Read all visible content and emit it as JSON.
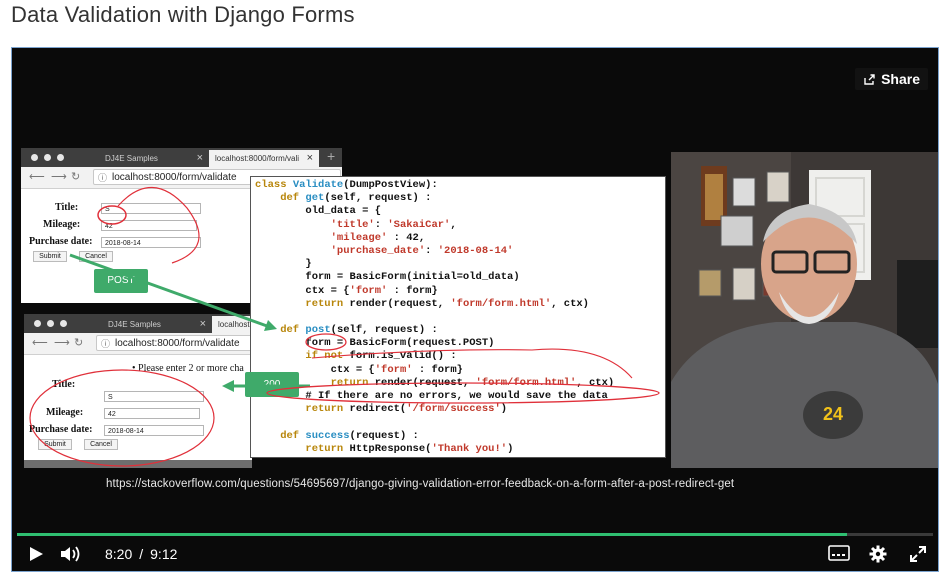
{
  "page": {
    "title": "Data Validation with Django Forms"
  },
  "player": {
    "share_label": "Share",
    "current_time": "8:20",
    "time_separator": "/",
    "duration": "9:12",
    "progress": 0.906,
    "accent_color": "#2fbf71"
  },
  "slide": {
    "browser_top": {
      "tab_inactive": "DJ4E Samples",
      "tab_active": "localhost:8000/form/vali",
      "url": "localhost:8000/form/validate",
      "labels": {
        "title": "Title:",
        "mileage": "Mileage:",
        "purchase_date": "Purchase date:"
      },
      "values": {
        "title": "S",
        "mileage": "42",
        "purchase_date": "2018-08-14"
      },
      "submit": "Submit",
      "cancel": "Cancel"
    },
    "browser_bottom": {
      "tab_inactive": "DJ4E Samples",
      "tab_active": "localhost",
      "url": "localhost:8000/form/validate",
      "error": "• Please enter 2 or more cha",
      "labels": {
        "title": "Title:",
        "mileage": "Mileage:",
        "purchase_date": "Purchase date:"
      },
      "values": {
        "title": "S",
        "mileage": "42",
        "purchase_date": "2018-08-14"
      },
      "submit": "Submit",
      "cancel": "Cancel"
    },
    "post_label": "POST",
    "status_label": "200",
    "code": {
      "l1_kw": "class ",
      "l1_fn": "Validate",
      "l1_rest": "(DumpPostView):",
      "l2_kw": "    def ",
      "l2_fn": "get",
      "l2_rest": "(self, request) :",
      "l3": "        old_data = {",
      "l4_st": "            'title'",
      "l4_mid": ": ",
      "l4_st2": "'SakaiCar'",
      "l4_end": ",",
      "l5_st": "            'mileage'",
      "l5_rest": " : 42,",
      "l6_st": "            'purchase_date'",
      "l6_mid": ": ",
      "l6_st2": "'2018-08-14'",
      "l7": "        }",
      "l8": "        form = BasicForm(initial=old_data)",
      "l9_a": "        ctx = {",
      "l9_st": "'form'",
      "l9_b": " : form}",
      "l10_kw": "        return",
      "l10_a": " render(request, ",
      "l10_st": "'form/form.html'",
      "l10_b": ", ctx)",
      "l12_kw": "    def ",
      "l12_fn": "post",
      "l12_rest": "(self, request) :",
      "l13": "        form = BasicForm(request.POST)",
      "l14_kw": "        if not",
      "l14_rest": " form.is_valid() :",
      "l15_a": "            ctx = {",
      "l15_st": "'form'",
      "l15_b": " : form}",
      "l16_kw": "            return",
      "l16_a": " render(request, ",
      "l16_st": "'form/form.html'",
      "l16_b": ", ctx)",
      "l17": "        # If there are no errors, we would save the data",
      "l18_kw": "        return",
      "l18_a": " redirect(",
      "l18_st": "'/form/success'",
      "l18_b": ")",
      "l20_kw": "    def ",
      "l20_fn": "success",
      "l20_rest": "(request) :",
      "l21_kw": "        return",
      "l21_a": " HttpResponse(",
      "l21_st": "'Thank you!'",
      "l21_b": ")"
    },
    "caption_url": "https://stackoverflow.com/questions/54695697/django-giving-validation-error-feedback-on-a-form-after-a-post-redirect-get"
  }
}
